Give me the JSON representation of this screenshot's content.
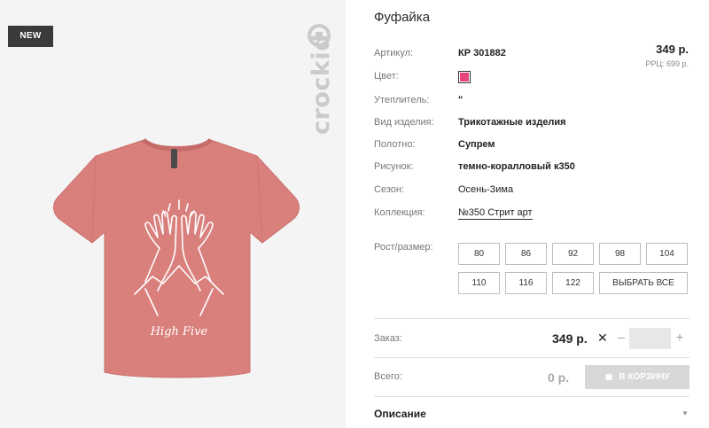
{
  "product_image": {
    "badge": "NEW",
    "brand_logo": "crockid",
    "print_text": "High Five",
    "colors": {
      "background": "#f4f4f4",
      "shirt": "#d9807d",
      "print": "#ffffff"
    }
  },
  "product": {
    "title": "Фуфайка",
    "price": "349 р.",
    "rrp": "РРЦ: 699 р."
  },
  "specs": {
    "article": {
      "label": "Артикул:",
      "value": "КР 301882"
    },
    "color": {
      "label": "Цвет:",
      "swatch": "#e8437a"
    },
    "insulation": {
      "label": "Утеплитель:",
      "value": "\""
    },
    "type": {
      "label": "Вид изделия:",
      "value": "Трикотажные изделия"
    },
    "fabric": {
      "label": "Полотно:",
      "value": "Супрем"
    },
    "pattern": {
      "label": "Рисунок:",
      "value": "темно-коралловый к350"
    },
    "season": {
      "label": "Сезон:",
      "value": "Осень-Зима"
    },
    "collection": {
      "label": "Коллекция:",
      "value": "№350 Стрит арт"
    }
  },
  "sizes": {
    "label": "Рост/размер:",
    "options": [
      "80",
      "86",
      "92",
      "98",
      "104",
      "110",
      "116",
      "122"
    ],
    "select_all": "ВЫБРАТЬ ВСЕ"
  },
  "order": {
    "label": "Заказ:",
    "price": "349 р.",
    "times": "✕",
    "minus": "–",
    "plus": "+",
    "quantity": ""
  },
  "total": {
    "label": "Всего:",
    "value": "0 р.",
    "cart_button": "В КОРЗИНУ"
  },
  "description": {
    "label": "Описание",
    "arrow": "▼"
  }
}
